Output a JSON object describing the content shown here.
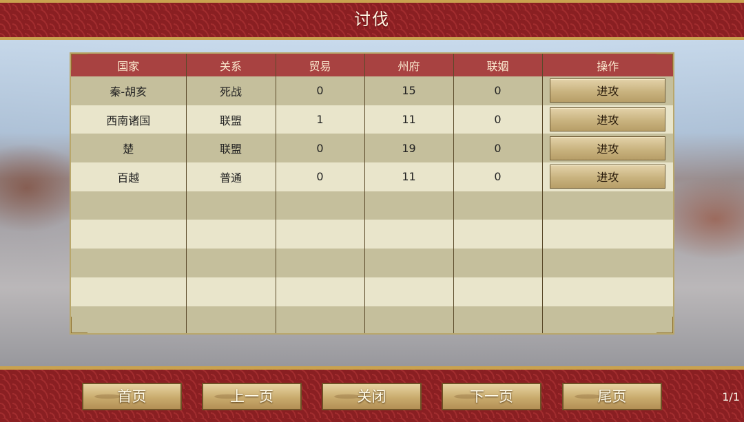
{
  "header": {
    "title": "讨伐"
  },
  "table": {
    "columns": [
      "国家",
      "关系",
      "贸易",
      "州府",
      "联姻",
      "操作"
    ],
    "rows": [
      {
        "country": "秦-胡亥",
        "relation": "死战",
        "trade": "0",
        "prefectures": "15",
        "marriage": "0",
        "action": "进攻"
      },
      {
        "country": "西南诸国",
        "relation": "联盟",
        "trade": "1",
        "prefectures": "11",
        "marriage": "0",
        "action": "进攻"
      },
      {
        "country": "楚",
        "relation": "联盟",
        "trade": "0",
        "prefectures": "19",
        "marriage": "0",
        "action": "进攻"
      },
      {
        "country": "百越",
        "relation": "普通",
        "trade": "0",
        "prefectures": "11",
        "marriage": "0",
        "action": "进攻"
      }
    ],
    "empty_rows": 5
  },
  "footer": {
    "first_label": "首页",
    "prev_label": "上一页",
    "close_label": "关闭",
    "next_label": "下一页",
    "last_label": "尾页",
    "page_indicator": "1/1"
  },
  "colors": {
    "banner_red": "#9b2a2d",
    "header_red": "#a84241",
    "gold_border": "#c9a24f"
  }
}
